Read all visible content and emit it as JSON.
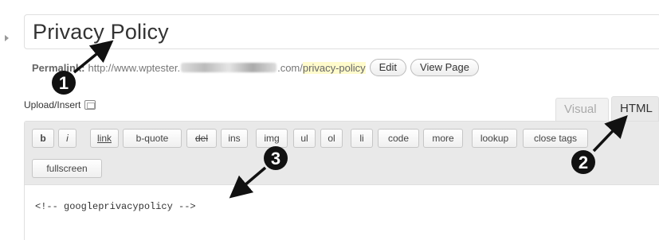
{
  "post": {
    "title": "Privacy Policy"
  },
  "permalink": {
    "label": "Permalink:",
    "url_prefix": "http://www.wptester.",
    "url_mid": ".com/",
    "slug": "privacy-policy",
    "edit_label": "Edit",
    "view_label": "View Page"
  },
  "upload": {
    "label": "Upload/Insert",
    "icon": "media-icon"
  },
  "tabs": {
    "visual": "Visual",
    "html": "HTML"
  },
  "toolbar": {
    "buttons": [
      "b",
      "i",
      "link",
      "b-quote",
      "del",
      "ins",
      "img",
      "ul",
      "ol",
      "li",
      "code",
      "more",
      "lookup",
      "close tags",
      "fullscreen"
    ]
  },
  "editor": {
    "content": "<!-- googleprivacypolicy -->"
  },
  "annotations": [
    "1",
    "2",
    "3"
  ],
  "colors": {
    "slug_highlight": "#fffbcc",
    "toolbar_bg": "#e9e9e9",
    "arrow": "#111111"
  }
}
